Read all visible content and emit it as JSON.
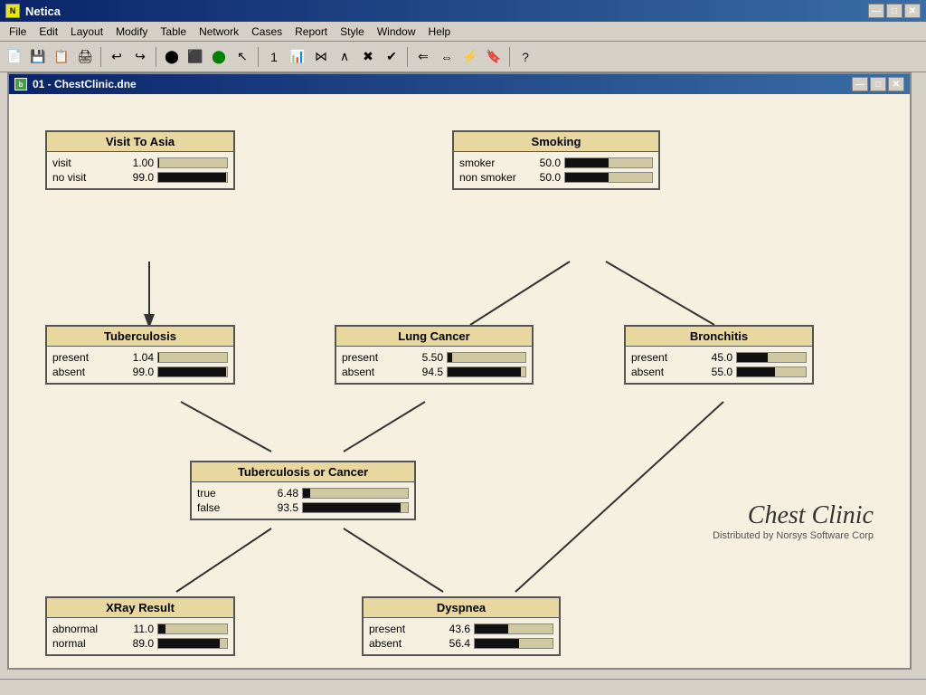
{
  "app": {
    "title": "Netica",
    "icon": "N"
  },
  "titlebar": {
    "minimize": "—",
    "maximize": "□",
    "close": "✕"
  },
  "menu": {
    "items": [
      "File",
      "Edit",
      "Layout",
      "Modify",
      "Table",
      "Network",
      "Cases",
      "Report",
      "Style",
      "Window",
      "Help"
    ]
  },
  "document": {
    "title": "01 - ChestClinic.dne",
    "icon": "b"
  },
  "nodes": {
    "visitToAsia": {
      "title": "Visit To Asia",
      "rows": [
        {
          "label": "visit",
          "value": "1.00",
          "pct": 1
        },
        {
          "label": "no visit",
          "value": "99.0",
          "pct": 99
        }
      ]
    },
    "smoking": {
      "title": "Smoking",
      "rows": [
        {
          "label": "smoker",
          "value": "50.0",
          "pct": 50
        },
        {
          "label": "non smoker",
          "value": "50.0",
          "pct": 50
        }
      ]
    },
    "tuberculosis": {
      "title": "Tuberculosis",
      "rows": [
        {
          "label": "present",
          "value": "1.04",
          "pct": 1.04
        },
        {
          "label": "absent",
          "value": "99.0",
          "pct": 99
        }
      ]
    },
    "lungCancer": {
      "title": "Lung Cancer",
      "rows": [
        {
          "label": "present",
          "value": "5.50",
          "pct": 5.5
        },
        {
          "label": "absent",
          "value": "94.5",
          "pct": 94.5
        }
      ]
    },
    "bronchitis": {
      "title": "Bronchitis",
      "rows": [
        {
          "label": "present",
          "value": "45.0",
          "pct": 45
        },
        {
          "label": "absent",
          "value": "55.0",
          "pct": 55
        }
      ]
    },
    "tubOrCancer": {
      "title": "Tuberculosis or Cancer",
      "rows": [
        {
          "label": "true",
          "value": "6.48",
          "pct": 6.48
        },
        {
          "label": "false",
          "value": "93.5",
          "pct": 93.5
        }
      ]
    },
    "xray": {
      "title": "XRay Result",
      "rows": [
        {
          "label": "abnormal",
          "value": "11.0",
          "pct": 11
        },
        {
          "label": "normal",
          "value": "89.0",
          "pct": 89
        }
      ]
    },
    "dyspnea": {
      "title": "Dyspnea",
      "rows": [
        {
          "label": "present",
          "value": "43.6",
          "pct": 43.6
        },
        {
          "label": "absent",
          "value": "56.4",
          "pct": 56.4
        }
      ]
    }
  },
  "chestClinic": {
    "title": "Chest Clinic",
    "subtitle": "Distributed by Norsys Software Corp"
  }
}
